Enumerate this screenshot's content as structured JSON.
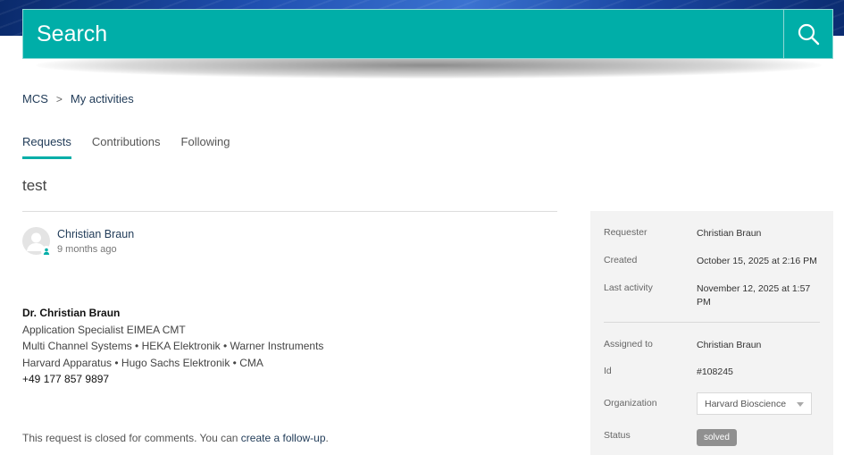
{
  "search": {
    "placeholder": "Search",
    "icon": "search-icon"
  },
  "breadcrumb": {
    "root": "MCS",
    "separator": ">",
    "current": "My activities"
  },
  "tabs": [
    {
      "label": "Requests",
      "active": true
    },
    {
      "label": "Contributions",
      "active": false
    },
    {
      "label": "Following",
      "active": false
    }
  ],
  "request": {
    "title": "test",
    "author": {
      "name": "Christian Braun",
      "time": "9 months ago",
      "avatar_icon": "user-icon"
    },
    "body": {
      "name": "Dr. Christian Braun",
      "line1": "Application Specialist EIMEA CMT",
      "line2": "Multi Channel Systems • HEKA Elektronik • Warner Instruments",
      "line3": "Harvard Apparatus • Hugo Sachs Elektronik • CMA",
      "phone": "+49 177 857 9897"
    },
    "closed_note": {
      "text": "This request is closed for comments. You can ",
      "link": "create a follow-up",
      "suffix": "."
    }
  },
  "sidebar": {
    "requester": {
      "label": "Requester",
      "value": "Christian Braun"
    },
    "created": {
      "label": "Created",
      "value": "October 15, 2025 at 2:16 PM"
    },
    "last_activity": {
      "label": "Last activity",
      "value": "November 12, 2025 at 1:57 PM"
    },
    "assigned_to": {
      "label": "Assigned to",
      "value": "Christian Braun"
    },
    "id": {
      "label": "Id",
      "value": "#108245"
    },
    "organization": {
      "label": "Organization",
      "value": "Harvard Bioscience"
    },
    "status": {
      "label": "Status",
      "value": "solved"
    }
  },
  "colors": {
    "accent": "#00aea8",
    "link": "#1f3a57",
    "status_badge": "#909090",
    "sidebar_bg": "#f3f3f3"
  }
}
